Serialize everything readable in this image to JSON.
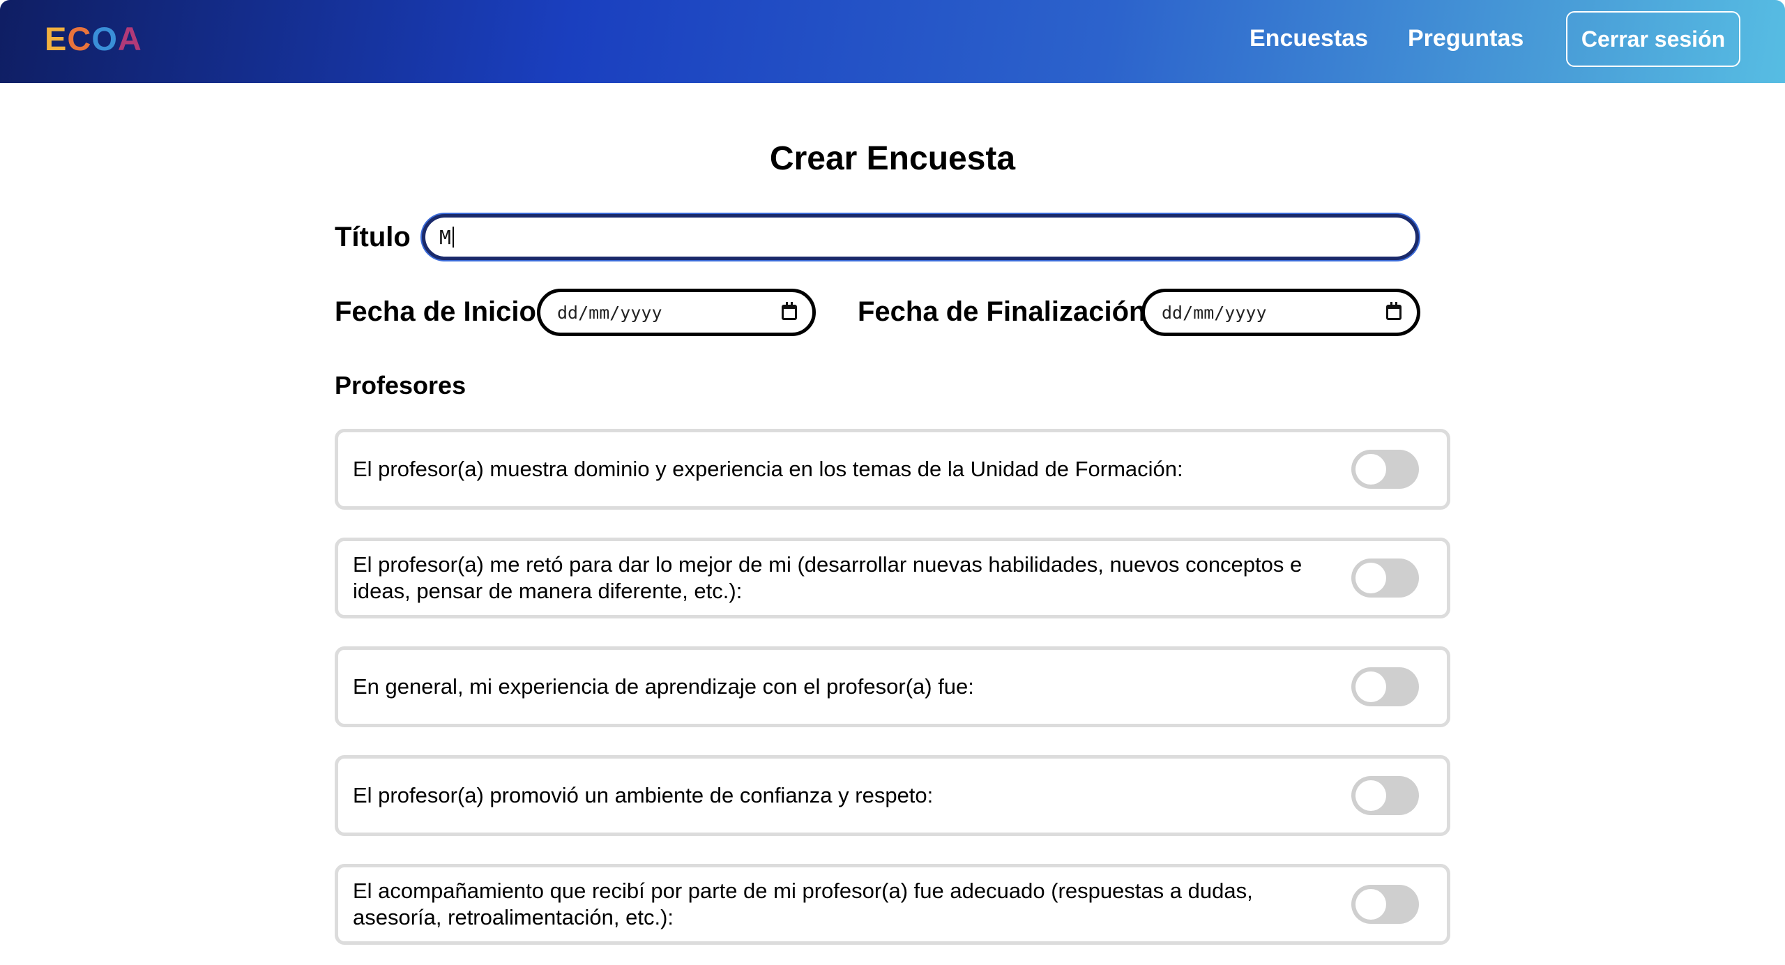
{
  "header": {
    "logo": [
      "E",
      "C",
      "O",
      "A"
    ],
    "nav": {
      "encuestas": "Encuestas",
      "preguntas": "Preguntas"
    },
    "logout_label": "Cerrar sesión"
  },
  "main": {
    "page_title": "Crear Encuesta",
    "title_label": "Título",
    "title_value": "M",
    "start_date_label": "Fecha de Inicio",
    "start_date_placeholder": "dd/mm/yyyy",
    "end_date_label": "Fecha de Finalización",
    "end_date_placeholder": "dd/mm/yyyy",
    "section_title": "Profesores",
    "questions": [
      {
        "text": "El profesor(a) muestra dominio y experiencia en los temas de la Unidad de Formación:",
        "enabled": false
      },
      {
        "text": "El profesor(a) me retó para dar lo mejor de mi (desarrollar nuevas habilidades, nuevos conceptos e ideas, pensar de manera diferente, etc.):",
        "enabled": false
      },
      {
        "text": "En general, mi experiencia de aprendizaje con el profesor(a) fue:",
        "enabled": false
      },
      {
        "text": "El profesor(a) promovió un ambiente de confianza y respeto:",
        "enabled": false
      },
      {
        "text": "El acompañamiento que recibí por parte de mi profesor(a) fue adecuado (respuestas a dudas, asesoría, retroalimentación, etc.):",
        "enabled": false
      }
    ]
  },
  "icons": {
    "calendar": "calendar-icon"
  },
  "colors": {
    "header_gradient_start": "#0f1e63",
    "header_gradient_end": "#57bde3",
    "input_focus_border": "#1a2a6b",
    "toggle_off": "#cfcfcf"
  }
}
